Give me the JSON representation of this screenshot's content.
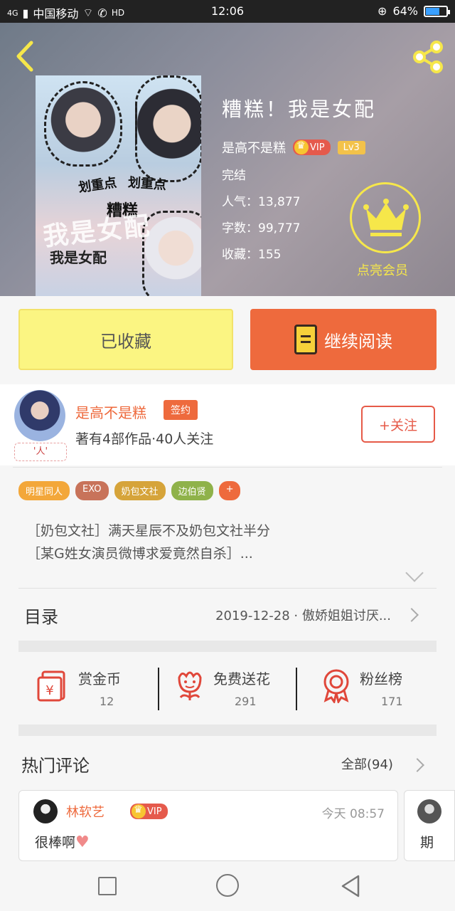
{
  "status_bar": {
    "network": "4G",
    "carrier": "中国移动",
    "hd": "HD",
    "time": "12:06",
    "battery": "64%",
    "battery_level": 0.64
  },
  "book": {
    "title": "糟糕！我是女配",
    "author": "是高不是糕",
    "vip_label": "VIP",
    "level": "Lv3",
    "status": "完结",
    "popularity_label": "人气：",
    "popularity": "13,877",
    "words_label": "字数：",
    "words": "99,777",
    "favorites_label": "收藏：",
    "favorites": "155",
    "cover_texts": [
      "划重点",
      "划重点",
      "糟糕",
      "我是女配",
      "我是女配"
    ]
  },
  "membership": {
    "label": "点亮会员"
  },
  "actions": {
    "collected": "已收藏",
    "continue_reading": "继续阅读"
  },
  "author_card": {
    "name": "是高不是糕",
    "signed": "签约",
    "description": "著有4部作品·40人关注",
    "avatar_tag": "'人'",
    "follow": "+关注"
  },
  "tags": [
    {
      "label": "明星同人",
      "color": "#f3a73a"
    },
    {
      "label": "EXO",
      "color": "#c8735a"
    },
    {
      "label": "奶包文社",
      "color": "#d6a43a"
    },
    {
      "label": "边伯贤",
      "color": "#8fb24a"
    },
    {
      "label": "+",
      "color": "#ee6a3d"
    }
  ],
  "intro": {
    "line1": "［奶包文社］满天星辰不及奶包文社半分",
    "line2": "［某G姓女演员微博求爱竟然自杀］..."
  },
  "catalog": {
    "label": "目录",
    "latest": "2019-12-28 · 傲娇姐姐讨厌..."
  },
  "stats": [
    {
      "label": "赏金币",
      "value": "12",
      "icon": "red-envelope-icon"
    },
    {
      "label": "免费送花",
      "value": "291",
      "icon": "flower-icon"
    },
    {
      "label": "粉丝榜",
      "value": "171",
      "icon": "ribbon-medal-icon"
    }
  ],
  "comments": {
    "title": "热门评论",
    "all_label": "全部(94)",
    "items": [
      {
        "name": "林软艺",
        "vip": "VIP",
        "time": "今天 08:57",
        "text": "很棒啊"
      },
      {
        "text": "期"
      }
    ]
  },
  "colors": {
    "accent": "#ee6a3d",
    "highlight": "#fbf582",
    "vip_gold": "#f6e74a"
  }
}
